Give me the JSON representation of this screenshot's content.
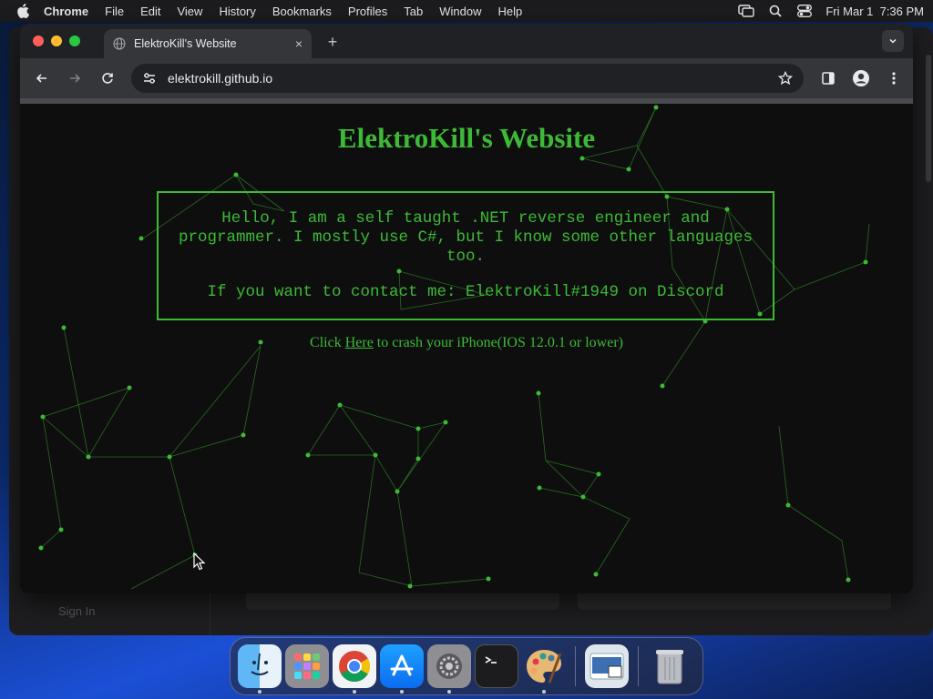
{
  "menubar": {
    "app_name": "Chrome",
    "items": [
      "File",
      "Edit",
      "View",
      "History",
      "Bookmarks",
      "Profiles",
      "Tab",
      "Window",
      "Help"
    ],
    "clock": "Fri Mar 1  7:36 PM"
  },
  "browser": {
    "tab_title": "ElektroKill's Website",
    "tab_close": "×",
    "new_tab": "+",
    "url": "elektrokill.github.io"
  },
  "page": {
    "title": "ElektroKill's Website",
    "intro": "Hello, I am a self taught .NET reverse engineer and programmer. I mostly use C#, but I know some other languages too.",
    "contact": "If you want to contact me: ElektroKill#1949 on Discord",
    "crash_prefix": "Click ",
    "crash_link": "Here",
    "crash_suffix": " to crash your iPhone(IOS 12.0.1 or lower)"
  },
  "background_window": {
    "sign_in": "Sign In"
  },
  "dock": {
    "apps": [
      "finder",
      "launchpad",
      "chrome",
      "app-store",
      "system-settings",
      "terminal",
      "paintbrush",
      "preview",
      "trash"
    ]
  },
  "colors": {
    "accent_green": "#3dba35",
    "page_bg": "#0e0e0f"
  }
}
